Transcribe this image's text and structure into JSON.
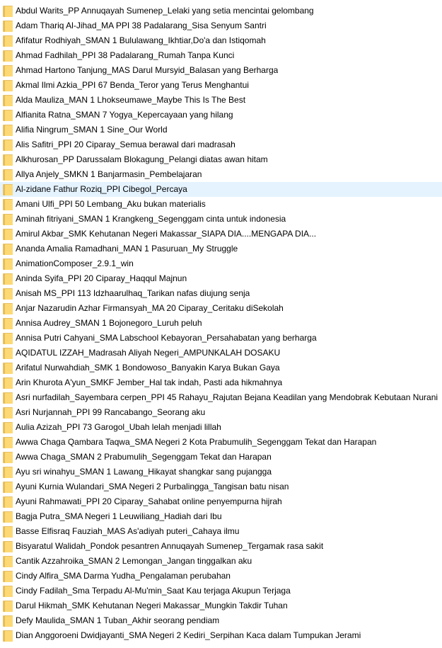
{
  "hover_index": 12,
  "colors": {
    "hover_background": "#e5f3ff",
    "folder_body": "#fcd974",
    "folder_back": "#e4c068"
  },
  "icon": "folder-icon",
  "items": [
    "Abdul Warits_PP Annuqayah Sumenep_Lelaki yang setia mencintai gelombang",
    "Adam Thariq Al-Jihad_MA PPI 38 Padalarang_Sisa Senyum Santri",
    "Afifatur Rodhiyah_SMAN 1 Bululawang_Ikhtiar,Do'a dan Istiqomah",
    "Ahmad Fadhilah_PPI 38 Padalarang_Rumah Tanpa Kunci",
    "Ahmad Hartono Tanjung_MAS Darul Mursyid_Balasan yang Berharga",
    "Akmal Ilmi Azkia_PPI 67 Benda_Teror yang Terus Menghantui",
    "Alda Mauliza_MAN 1 Lhokseumawe_Maybe This Is The Best",
    "Alfianita Ratna_SMAN 7 Yogya_Kepercayaan yang hilang",
    "Alifia Ningrum_SMAN 1 Sine_Our World",
    "Alis Safitri_PPI 20 Ciparay_Semua berawal dari madrasah",
    "Alkhurosan_PP Darussalam Blokagung_Pelangi diatas awan hitam",
    "Allya Anjely_SMKN 1 Banjarmasin_Pembelajaran",
    "Al-zidane Fathur Roziq_PPI Cibegol_Percaya",
    "Amani Ulfi_PPI 50 Lembang_Aku bukan materialis",
    "Aminah fitriyani_SMAN 1 Krangkeng_Segenggam cinta untuk indonesia",
    "Amirul Akbar_SMK Kehutanan Negeri Makassar_SIAPA DIA....MENGAPA DIA...",
    "Ananda Amalia Ramadhani_MAN 1 Pasuruan_My Struggle",
    "AnimationComposer_2.9.1_win",
    "Aninda Syifa_PPI 20 Ciparay_Haqqul Majnun",
    "Anisah MS_PPI 113 Idzhaarulhaq_Tarikan nafas diujung senja",
    "Anjar Nazarudin Azhar Firmansyah_MA 20 Ciparay_Ceritaku diSekolah",
    "Annisa Audrey_SMAN 1 Bojonegoro_Luruh peluh",
    "Annisa Putri Cahyani_SMA Labschool Kebayoran_Persahabatan yang berharga",
    "AQIDATUL IZZAH_Madrasah Aliyah Negeri_AMPUNKALAH  DOSAKU",
    "Arifatul Nurwahdiah_SMK 1 Bondowoso_Banyakin Karya Bukan Gaya",
    "Arin Khurota A'yun_SMKF Jember_Hal tak indah, Pasti ada hikmahnya",
    "Asri nurfadilah_Sayembara cerpen_PPI 45 Rahayu_Rajutan Bejana Keadilan yang Mendobrak Kebutaan Nurani",
    "Asri Nurjannah_PPI 99 Rancabango_Seorang aku",
    "Aulia Azizah_PPI 73 Garogol_Ubah lelah menjadi lillah",
    "Awwa Chaga Qambara Taqwa_SMA Negeri 2 Kota Prabumulih_Segenggam Tekat dan Harapan",
    "Awwa Chaga_SMAN 2 Prabumulih_Segenggam Tekat dan Harapan",
    "Ayu sri winahyu_SMAN 1 Lawang_Hikayat shangkar sang pujangga",
    "Ayuni Kurnia Wulandari_SMA Negeri 2 Purbalingga_Tangisan batu nisan",
    "Ayuni Rahmawati_PPI 20 Ciparay_Sahabat online penyempurna hijrah",
    "Bagja Putra_SMA Negeri 1 Leuwiliang_Hadiah dari Ibu",
    "Basse Elfisraq Fauziah_MAS As'adiyah puteri_Cahaya ilmu",
    "Bisyaratul Walidah_Pondok pesantren Annuqayah Sumenep_Tergamak rasa sakit",
    "Cantik Azzahroika_SMAN 2 Lemongan_Jangan tinggalkan aku",
    "Cindy Alfira_SMA Darma Yudha_Pengalaman perubahan",
    "Cindy Fadilah_Sma Terpadu Al-Mu'min_Saat Kau terjaga Akupun Terjaga",
    "Darul Hikmah_SMK Kehutanan Negeri Makassar_Mungkin Takdir Tuhan",
    "Defy Maulida_SMAN 1 Tuban_Akhir seorang pendiam",
    "Dian Anggoroeni Dwidjayanti_SMA Negeri 2 Kediri_Serpihan Kaca dalam Tumpukan Jerami"
  ]
}
